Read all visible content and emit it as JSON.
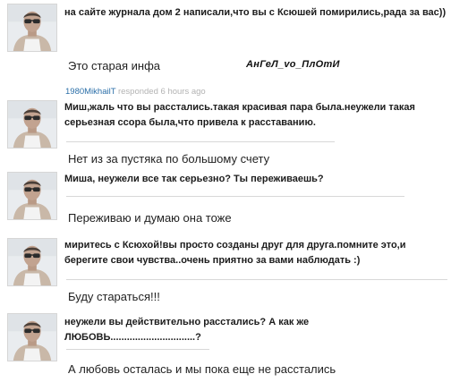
{
  "questions": [
    {
      "text": "на сайте журнала дом 2 написали,что вы с Ксюшей помирились,рада за вас))",
      "answer": "Это старая инфа"
    },
    {
      "text": "Миш,жаль что вы расстались.такая красивая пара была.неужели такая серьезная ссора была,что привела к расставанию.",
      "answer": "Нет из за пустяка по большому счету"
    },
    {
      "text": "Миша, неужели все так серьезно? Ты переживаешь?",
      "answer": "Переживаю и думаю она тоже"
    },
    {
      "text": "миритесь с Ксюхой!вы просто созданы друг для друга.помните это,и берегите свои чувства..очень приятно за вами наблюдать :)",
      "answer": "Буду стараться!!!"
    },
    {
      "text": "неужели вы действительно расстались? А как же ЛЮБОВЬ...............................?",
      "answer": "А любовь осталась и мы пока еще не расстались"
    }
  ],
  "signature": "АнГеЛ_vo_ПлОтИ",
  "meta": {
    "user": "1980MikhailT",
    "action": "responded",
    "time": "6 hours ago"
  }
}
